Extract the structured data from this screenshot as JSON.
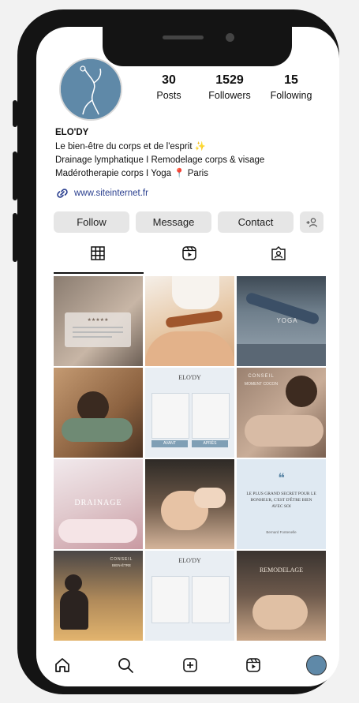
{
  "profile": {
    "posts_count": "30",
    "posts_label": "Posts",
    "followers_count": "1529",
    "followers_label": "Followers",
    "following_count": "15",
    "following_label": "Following",
    "username": "ELO'DY",
    "bio_line1": "Le bien-être du corps et de l'esprit ✨",
    "bio_line2": "Drainage lymphatique I Remodelage corps & visage",
    "bio_line3": "Madérotherapie corps I Yoga 📍 Paris",
    "link": "www.siteinternet.fr"
  },
  "actions": {
    "follow": "Follow",
    "message": "Message",
    "contact": "Contact"
  },
  "grid": {
    "post1_stars": "★★★★★",
    "post2_brand": "ELO'DY",
    "post2_before": "AVANT",
    "post2_after": "APRÈS",
    "post3_title": "CONSEIL",
    "post3_subtitle": "MOMENT COCON",
    "post4_title": "DRAINAGE",
    "post5_quote_mark": "❝",
    "post5_quote": "LE PLUS GRAND SECRET POUR LE BONHEUR, C'EST D'ÊTRE BIEN AVEC SOI",
    "post5_author": "Bernard Fontenelle",
    "post6_title": "CONSEIL",
    "post6_subtitle": "BIEN-ÊTRE",
    "post7_brand": "ELO'DY",
    "post8_title": "REMODELAGE",
    "yoga_label": "YOGA"
  },
  "colors": {
    "avatar_bg": "#5f89a8",
    "link": "#2a3f8f",
    "button_bg": "#e6e6e6"
  },
  "icons": {
    "nav_home": "home-icon",
    "nav_search": "search-icon",
    "nav_add": "add-post-icon",
    "nav_reels": "reels-icon",
    "tab_grid": "grid-icon",
    "tab_reels": "reels-icon",
    "tab_tagged": "tagged-icon"
  }
}
